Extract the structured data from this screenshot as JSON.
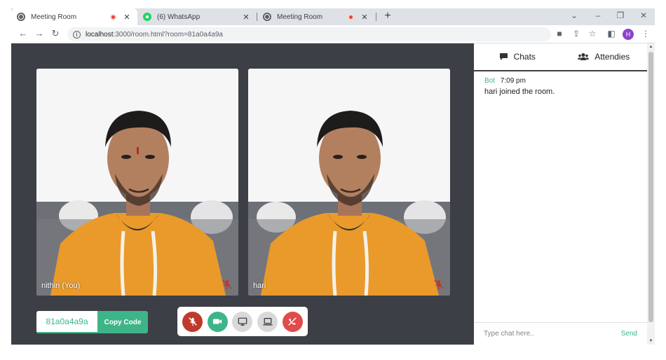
{
  "browser": {
    "tabs": [
      {
        "title": "Meeting Room",
        "recording": true,
        "favicon": "globe-icon"
      },
      {
        "title": "(6) WhatsApp",
        "recording": false,
        "favicon": "whatsapp-icon"
      },
      {
        "title": "Meeting Room",
        "recording": true,
        "favicon": "globe-icon"
      }
    ],
    "url_host": "localhost",
    "url_path": ":3000/room.html?room=81a0a4a9a",
    "avatar_initial": "H"
  },
  "room": {
    "tiles": [
      {
        "name": "nithin (You)",
        "muted": true
      },
      {
        "name": "hari",
        "muted": true
      }
    ],
    "room_code": "81a0a4a9a",
    "copy_label": "Copy Code"
  },
  "panel": {
    "tabs": [
      {
        "label": "Chats",
        "icon": "chat-icon"
      },
      {
        "label": "Attendies",
        "icon": "users-icon"
      }
    ],
    "messages": [
      {
        "author": "Bot",
        "time": "7:09 pm",
        "text": "hari joined the room."
      }
    ],
    "input_placeholder": "Type chat here..",
    "send_label": "Send"
  },
  "colors": {
    "accent": "#3eb489",
    "stage": "#3c3f45",
    "mute_red": "#c0392b",
    "hoodie": "#e99a2b"
  }
}
